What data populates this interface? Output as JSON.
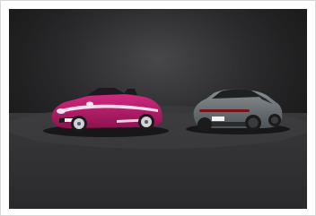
{
  "image": {
    "subject": "two-cars-studio-photo",
    "colors": {
      "backdrop": "#262628",
      "floor": "#3a3a3c",
      "left_car_body": "#b81b6c",
      "left_car_stripe": "#ffffff",
      "right_car_body": "#6e7378",
      "wheel": "#1b1b1c",
      "rim": "#cfd2d6"
    },
    "left_plate": "",
    "right_plate": ""
  }
}
